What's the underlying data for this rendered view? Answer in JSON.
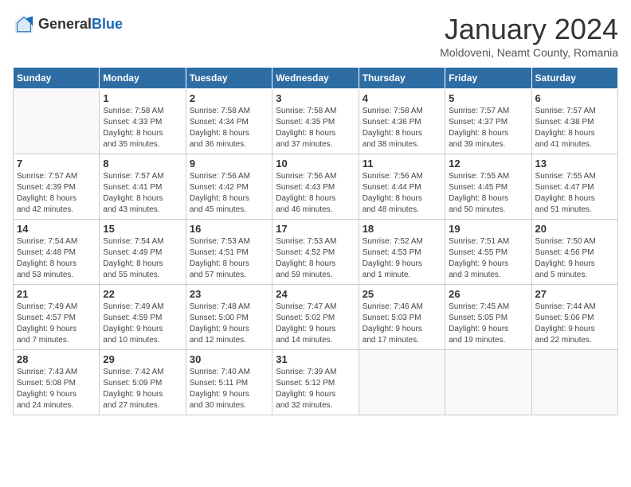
{
  "header": {
    "logo_general": "General",
    "logo_blue": "Blue",
    "title": "January 2024",
    "subtitle": "Moldoveni, Neamt County, Romania"
  },
  "days_of_week": [
    "Sunday",
    "Monday",
    "Tuesday",
    "Wednesday",
    "Thursday",
    "Friday",
    "Saturday"
  ],
  "weeks": [
    [
      {
        "day": "",
        "info": ""
      },
      {
        "day": "1",
        "info": "Sunrise: 7:58 AM\nSunset: 4:33 PM\nDaylight: 8 hours\nand 35 minutes."
      },
      {
        "day": "2",
        "info": "Sunrise: 7:58 AM\nSunset: 4:34 PM\nDaylight: 8 hours\nand 36 minutes."
      },
      {
        "day": "3",
        "info": "Sunrise: 7:58 AM\nSunset: 4:35 PM\nDaylight: 8 hours\nand 37 minutes."
      },
      {
        "day": "4",
        "info": "Sunrise: 7:58 AM\nSunset: 4:36 PM\nDaylight: 8 hours\nand 38 minutes."
      },
      {
        "day": "5",
        "info": "Sunrise: 7:57 AM\nSunset: 4:37 PM\nDaylight: 8 hours\nand 39 minutes."
      },
      {
        "day": "6",
        "info": "Sunrise: 7:57 AM\nSunset: 4:38 PM\nDaylight: 8 hours\nand 41 minutes."
      }
    ],
    [
      {
        "day": "7",
        "info": "Sunrise: 7:57 AM\nSunset: 4:39 PM\nDaylight: 8 hours\nand 42 minutes."
      },
      {
        "day": "8",
        "info": "Sunrise: 7:57 AM\nSunset: 4:41 PM\nDaylight: 8 hours\nand 43 minutes."
      },
      {
        "day": "9",
        "info": "Sunrise: 7:56 AM\nSunset: 4:42 PM\nDaylight: 8 hours\nand 45 minutes."
      },
      {
        "day": "10",
        "info": "Sunrise: 7:56 AM\nSunset: 4:43 PM\nDaylight: 8 hours\nand 46 minutes."
      },
      {
        "day": "11",
        "info": "Sunrise: 7:56 AM\nSunset: 4:44 PM\nDaylight: 8 hours\nand 48 minutes."
      },
      {
        "day": "12",
        "info": "Sunrise: 7:55 AM\nSunset: 4:45 PM\nDaylight: 8 hours\nand 50 minutes."
      },
      {
        "day": "13",
        "info": "Sunrise: 7:55 AM\nSunset: 4:47 PM\nDaylight: 8 hours\nand 51 minutes."
      }
    ],
    [
      {
        "day": "14",
        "info": "Sunrise: 7:54 AM\nSunset: 4:48 PM\nDaylight: 8 hours\nand 53 minutes."
      },
      {
        "day": "15",
        "info": "Sunrise: 7:54 AM\nSunset: 4:49 PM\nDaylight: 8 hours\nand 55 minutes."
      },
      {
        "day": "16",
        "info": "Sunrise: 7:53 AM\nSunset: 4:51 PM\nDaylight: 8 hours\nand 57 minutes."
      },
      {
        "day": "17",
        "info": "Sunrise: 7:53 AM\nSunset: 4:52 PM\nDaylight: 8 hours\nand 59 minutes."
      },
      {
        "day": "18",
        "info": "Sunrise: 7:52 AM\nSunset: 4:53 PM\nDaylight: 9 hours\nand 1 minute."
      },
      {
        "day": "19",
        "info": "Sunrise: 7:51 AM\nSunset: 4:55 PM\nDaylight: 9 hours\nand 3 minutes."
      },
      {
        "day": "20",
        "info": "Sunrise: 7:50 AM\nSunset: 4:56 PM\nDaylight: 9 hours\nand 5 minutes."
      }
    ],
    [
      {
        "day": "21",
        "info": "Sunrise: 7:49 AM\nSunset: 4:57 PM\nDaylight: 9 hours\nand 7 minutes."
      },
      {
        "day": "22",
        "info": "Sunrise: 7:49 AM\nSunset: 4:59 PM\nDaylight: 9 hours\nand 10 minutes."
      },
      {
        "day": "23",
        "info": "Sunrise: 7:48 AM\nSunset: 5:00 PM\nDaylight: 9 hours\nand 12 minutes."
      },
      {
        "day": "24",
        "info": "Sunrise: 7:47 AM\nSunset: 5:02 PM\nDaylight: 9 hours\nand 14 minutes."
      },
      {
        "day": "25",
        "info": "Sunrise: 7:46 AM\nSunset: 5:03 PM\nDaylight: 9 hours\nand 17 minutes."
      },
      {
        "day": "26",
        "info": "Sunrise: 7:45 AM\nSunset: 5:05 PM\nDaylight: 9 hours\nand 19 minutes."
      },
      {
        "day": "27",
        "info": "Sunrise: 7:44 AM\nSunset: 5:06 PM\nDaylight: 9 hours\nand 22 minutes."
      }
    ],
    [
      {
        "day": "28",
        "info": "Sunrise: 7:43 AM\nSunset: 5:08 PM\nDaylight: 9 hours\nand 24 minutes."
      },
      {
        "day": "29",
        "info": "Sunrise: 7:42 AM\nSunset: 5:09 PM\nDaylight: 9 hours\nand 27 minutes."
      },
      {
        "day": "30",
        "info": "Sunrise: 7:40 AM\nSunset: 5:11 PM\nDaylight: 9 hours\nand 30 minutes."
      },
      {
        "day": "31",
        "info": "Sunrise: 7:39 AM\nSunset: 5:12 PM\nDaylight: 9 hours\nand 32 minutes."
      },
      {
        "day": "",
        "info": ""
      },
      {
        "day": "",
        "info": ""
      },
      {
        "day": "",
        "info": ""
      }
    ]
  ]
}
